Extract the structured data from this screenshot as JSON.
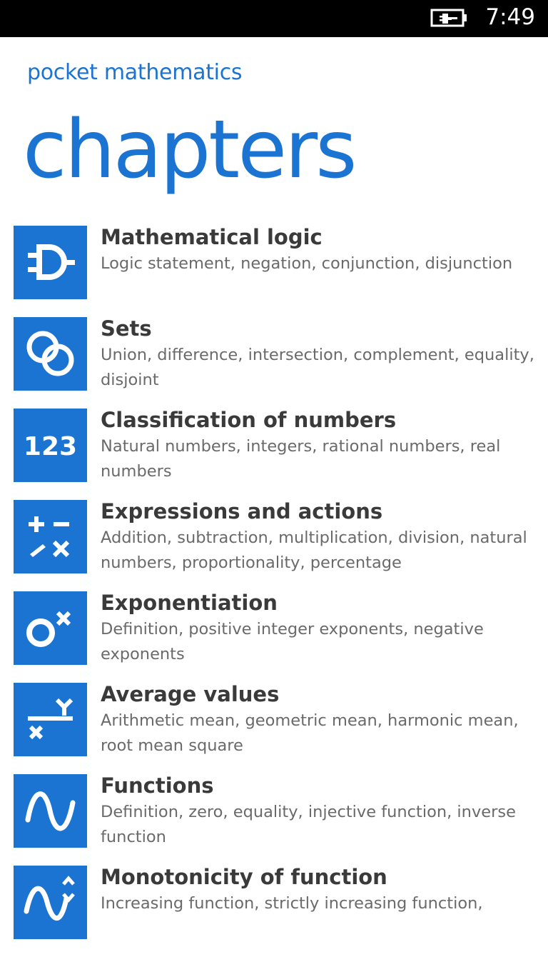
{
  "status_bar": {
    "battery_icon": "battery-charging-icon",
    "time": "7:49"
  },
  "header": {
    "app_title": "pocket mathematics",
    "page_title": "chapters"
  },
  "colors": {
    "accent": "#1b74d2",
    "title_text": "#3a3a3a",
    "desc_text": "#6a6a6a",
    "status_bar": "#000000"
  },
  "chapters": [
    {
      "title": "Mathematical logic",
      "description": "Logic statement, negation, conjunction, disjunction",
      "icon": "logic-gate-icon"
    },
    {
      "title": "Sets",
      "description": "Union, difference, intersection, complement, equality, disjoint",
      "icon": "sets-icon"
    },
    {
      "title": "Classification of numbers",
      "description": "Natural numbers, integers, rational numbers, real numbers",
      "icon": "numbers-icon",
      "icon_text": "123"
    },
    {
      "title": "Expressions and actions",
      "description": "Addition, subtraction, multiplication, division, natural numbers, proportionality, percentage",
      "icon": "operations-icon"
    },
    {
      "title": "Exponentiation",
      "description": "Definition, positive integer exponents, negative exponents",
      "icon": "exponent-icon"
    },
    {
      "title": "Average values",
      "description": "Arithmetic mean, geometric mean, harmonic mean, root mean square",
      "icon": "average-icon"
    },
    {
      "title": "Functions",
      "description": "Definition, zero, equality, injective function, inverse function",
      "icon": "function-wave-icon"
    },
    {
      "title": "Monotonicity of function",
      "description": "Increasing function, strictly increasing function,",
      "icon": "monotonicity-icon"
    }
  ]
}
